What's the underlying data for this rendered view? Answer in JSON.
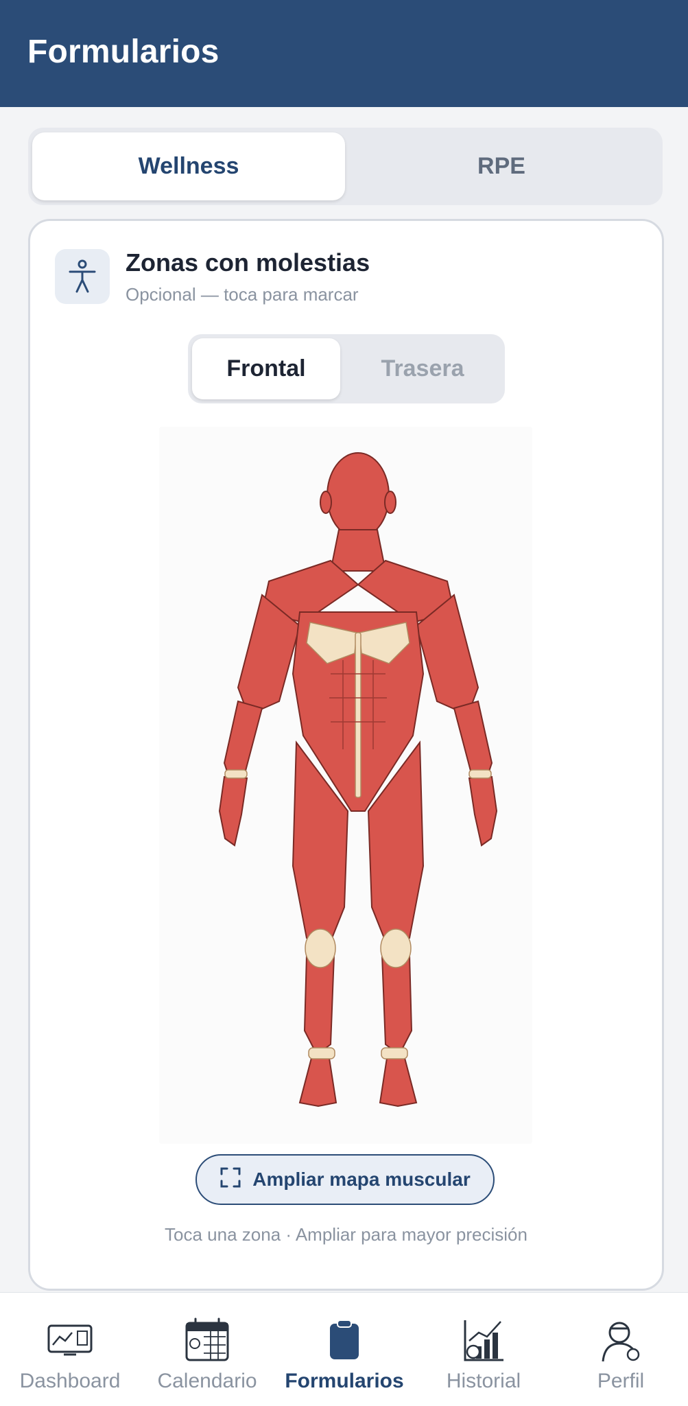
{
  "header": {
    "title": "Formularios"
  },
  "tabs": [
    {
      "label": "Wellness",
      "active": true
    },
    {
      "label": "RPE",
      "active": false
    }
  ],
  "card": {
    "icon": "person-accessibility-icon",
    "title": "Zonas con molestias",
    "subtitle": "Opcional — toca para marcar",
    "view_toggle": [
      {
        "label": "Frontal",
        "active": true
      },
      {
        "label": "Trasera",
        "active": false
      }
    ],
    "body_map_view": "front",
    "expand_button": {
      "icon": "expand-icon",
      "label": "Ampliar mapa muscular"
    },
    "hint": "Toca una zona · Ampliar para mayor precisión"
  },
  "bottom_nav": [
    {
      "icon": "dashboard-icon",
      "label": "Dashboard",
      "active": false
    },
    {
      "icon": "calendar-icon",
      "label": "Calendario",
      "active": false
    },
    {
      "icon": "clipboard-icon",
      "label": "Formularios",
      "active": true
    },
    {
      "icon": "analytics-icon",
      "label": "Historial",
      "active": false
    },
    {
      "icon": "player-profile-icon",
      "label": "Perfil",
      "active": false
    }
  ],
  "colors": {
    "primary": "#2b4c77",
    "muscle": "#d8554d",
    "tendon": "#f3e2c4"
  }
}
